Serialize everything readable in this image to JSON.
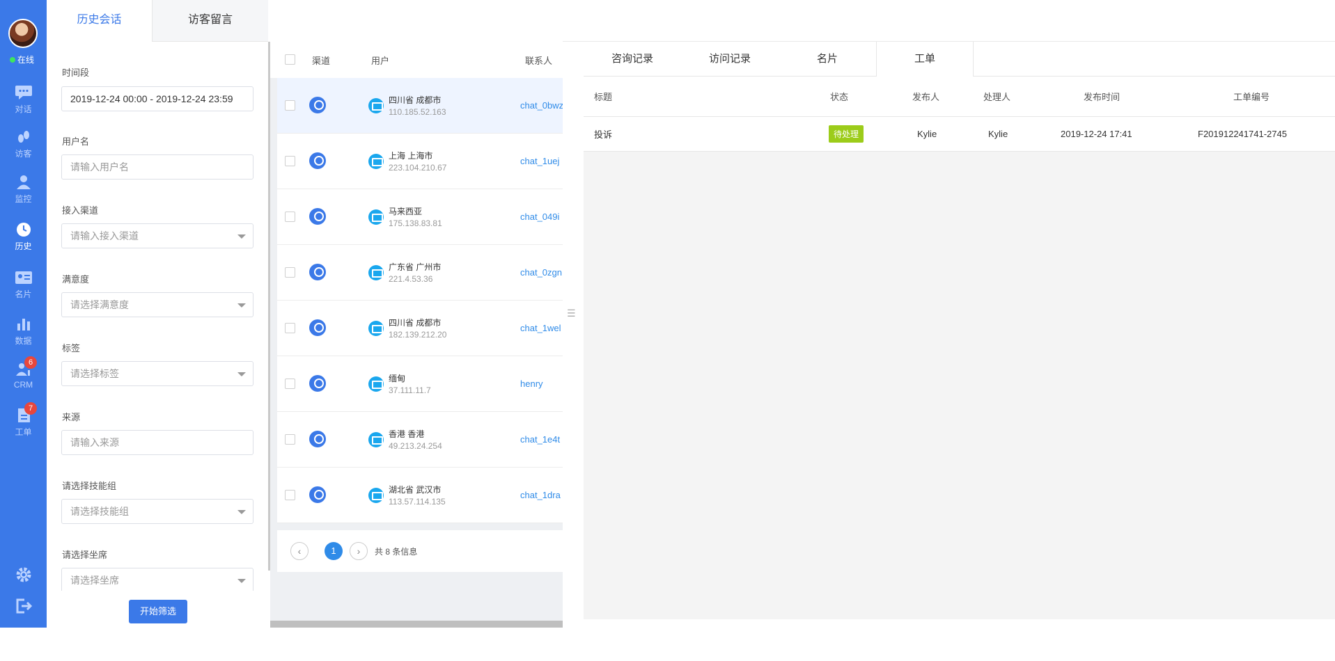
{
  "nav": {
    "status": "在线",
    "items": [
      {
        "label": "对话",
        "icon": "chat-icon"
      },
      {
        "label": "访客",
        "icon": "footprint-icon"
      },
      {
        "label": "监控",
        "icon": "monitor-user-icon"
      },
      {
        "label": "历史",
        "icon": "clock-icon"
      },
      {
        "label": "名片",
        "icon": "card-icon"
      },
      {
        "label": "数据",
        "icon": "bar-chart-icon"
      },
      {
        "label": "CRM",
        "icon": "crm-icon",
        "badge": "6"
      },
      {
        "label": "工单",
        "icon": "ticket-icon",
        "badge": "7"
      }
    ],
    "bottom_icons": [
      "gear-icon",
      "logout-icon"
    ]
  },
  "filter": {
    "tabs": [
      "历史会话",
      "访客留言"
    ],
    "time_label": "时间段",
    "time_value": "2019-12-24 00:00    -    2019-12-24 23:59",
    "username_label": "用户名",
    "username_placeholder": "请输入用户名",
    "channel_label": "接入渠道",
    "channel_placeholder": "请输入接入渠道",
    "satisfaction_label": "满意度",
    "satisfaction_placeholder": "请选择满意度",
    "tag_label": "标签",
    "tag_placeholder": "请选择标签",
    "source_label": "来源",
    "source_placeholder": "请输入来源",
    "skill_label": "请选择技能组",
    "skill_placeholder": "请选择技能组",
    "seat_label": "请选择坐席",
    "seat_placeholder": "请选择坐席",
    "submit": "开始筛选"
  },
  "list": {
    "columns": [
      "渠道",
      "用户",
      "联系人"
    ],
    "rows": [
      {
        "location": "四川省 成都市",
        "ip": "110.185.52.163",
        "contact": "chat_0bwz"
      },
      {
        "location": "上海 上海市",
        "ip": "223.104.210.67",
        "contact": "chat_1uej"
      },
      {
        "location": "马来西亚",
        "ip": "175.138.83.81",
        "contact": "chat_049i"
      },
      {
        "location": "广东省 广州市",
        "ip": "221.4.53.36",
        "contact": "chat_0zgn"
      },
      {
        "location": "四川省 成都市",
        "ip": "182.139.212.20",
        "contact": "chat_1wel"
      },
      {
        "location": "缅甸",
        "ip": "37.111.11.7",
        "contact": "henry"
      },
      {
        "location": "香港 香港",
        "ip": "49.213.24.254",
        "contact": "chat_1e4t"
      },
      {
        "location": "湖北省 武汉市",
        "ip": "113.57.114.135",
        "contact": "chat_1dra"
      }
    ],
    "pager": {
      "prev": "‹",
      "current": "1",
      "next": "›",
      "total": "共 8 条信息"
    }
  },
  "detail": {
    "tabs": [
      "咨询记录",
      "访问记录",
      "名片",
      "工单"
    ],
    "columns": [
      "标题",
      "状态",
      "发布人",
      "处理人",
      "发布时间",
      "工单编号"
    ],
    "ticket": {
      "title": "投诉",
      "status": "待处理",
      "publisher": "Kylie",
      "handler": "Kylie",
      "time": "2019-12-24 17:41",
      "number": "F201912241741-2745"
    }
  }
}
